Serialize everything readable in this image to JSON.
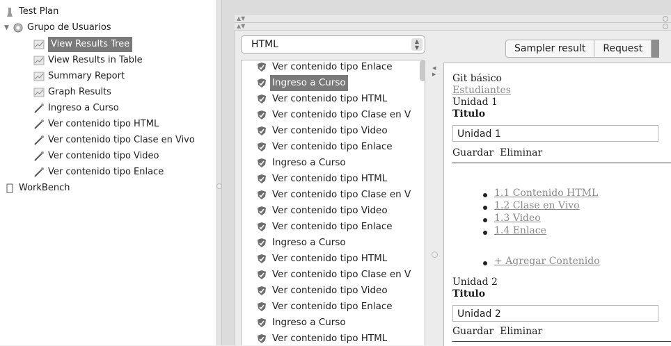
{
  "tree": {
    "items": [
      {
        "label": "Test Plan",
        "icon": "test-plan-icon"
      },
      {
        "label": "Grupo de Usuarios",
        "icon": "gear-icon"
      },
      {
        "label": "View Results Tree",
        "icon": "chart-icon",
        "selected": true
      },
      {
        "label": "View Results in Table",
        "icon": "chart-icon"
      },
      {
        "label": "Summary Report",
        "icon": "chart-icon"
      },
      {
        "label": "Graph Results",
        "icon": "chart-icon"
      },
      {
        "label": "Ingreso a Curso",
        "icon": "pipette-icon"
      },
      {
        "label": "Ver contenido tipo HTML",
        "icon": "pipette-icon"
      },
      {
        "label": "Ver contenido tipo Clase en Vivo",
        "icon": "pipette-icon"
      },
      {
        "label": "Ver contenido tipo Video",
        "icon": "pipette-icon"
      },
      {
        "label": "Ver contenido tipo Enlace",
        "icon": "pipette-icon"
      },
      {
        "label": "WorkBench",
        "icon": "workbench-icon"
      }
    ]
  },
  "renderer": {
    "selected": "HTML"
  },
  "samples": [
    {
      "label": "Ver contenido tipo Enlace"
    },
    {
      "label": "Ingreso a Curso",
      "selected": true
    },
    {
      "label": "Ver contenido tipo HTML"
    },
    {
      "label": "Ver contenido tipo Clase en V"
    },
    {
      "label": "Ver contenido tipo Video"
    },
    {
      "label": "Ver contenido tipo Enlace"
    },
    {
      "label": "Ingreso a Curso"
    },
    {
      "label": "Ver contenido tipo HTML"
    },
    {
      "label": "Ver contenido tipo Clase en V"
    },
    {
      "label": "Ver contenido tipo Video"
    },
    {
      "label": "Ver contenido tipo Enlace"
    },
    {
      "label": "Ingreso a Curso"
    },
    {
      "label": "Ver contenido tipo HTML"
    },
    {
      "label": "Ver contenido tipo Clase en V"
    },
    {
      "label": "Ver contenido tipo Video"
    },
    {
      "label": "Ver contenido tipo Enlace"
    },
    {
      "label": "Ingreso a Curso"
    },
    {
      "label": "Ver contenido tipo HTML"
    }
  ],
  "tabs": [
    {
      "label": "Sampler result"
    },
    {
      "label": "Request"
    }
  ],
  "html_view": {
    "heading": "Git básico",
    "breadcrumb_link": "Estudiantes",
    "unit1": {
      "name": "Unidad 1",
      "title_label": "Titulo",
      "input_value": "Unidad 1",
      "save": "Guardar",
      "delete": "Eliminar"
    },
    "contents": [
      "1.1 Contenido HTML",
      "1.2 Clase en Vivo",
      "1.3 Video",
      "1.4 Enlace"
    ],
    "add_content": "+ Agregar Contenido",
    "unit2": {
      "name": "Unidad 2",
      "title_label": "Titulo",
      "input_value": "Unidad 2",
      "save": "Guardar",
      "delete": "Eliminar"
    }
  },
  "colors": {
    "selection": "#7a7a7a",
    "shield": "#6e6e6e",
    "link": "#8a8a8a"
  }
}
